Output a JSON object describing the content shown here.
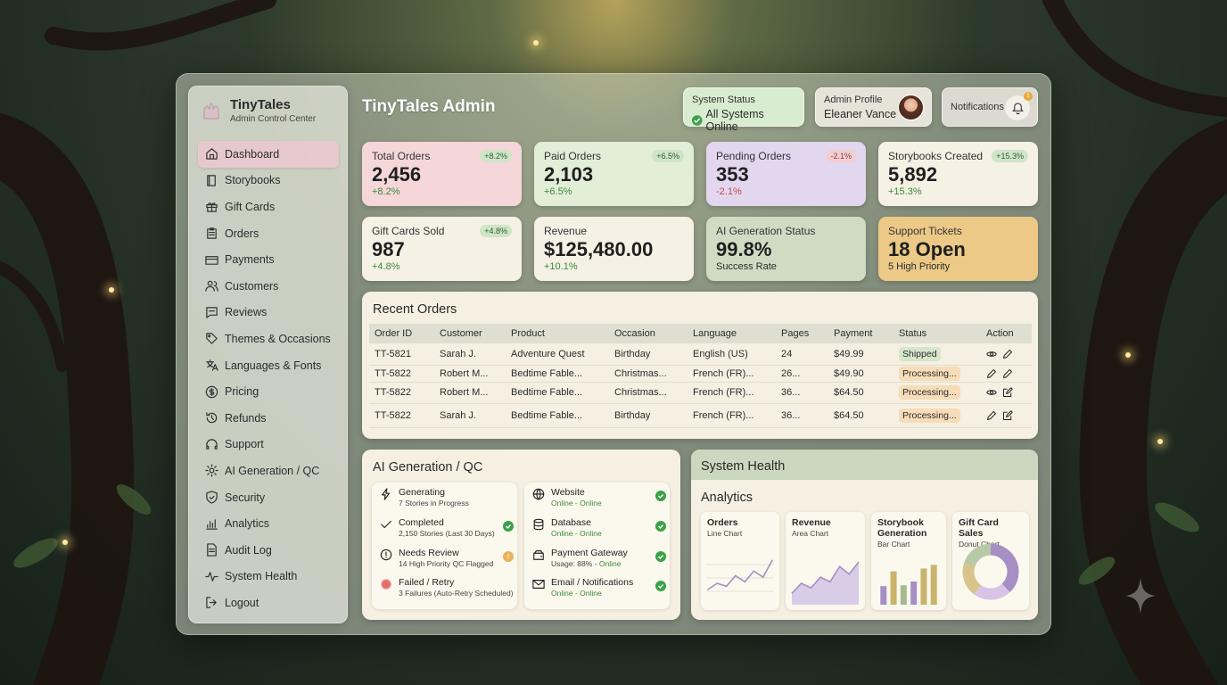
{
  "app": {
    "brand_name": "TinyTales",
    "brand_subtitle": "Admin Control Center",
    "title": "TinyTales Admin"
  },
  "sidebar": {
    "items": [
      {
        "label": "Dashboard",
        "icon": "home-icon",
        "active": true
      },
      {
        "label": "Storybooks",
        "icon": "book-icon"
      },
      {
        "label": "Gift Cards",
        "icon": "gift-icon"
      },
      {
        "label": "Orders",
        "icon": "clipboard-icon"
      },
      {
        "label": "Payments",
        "icon": "credit-card-icon"
      },
      {
        "label": "Customers",
        "icon": "users-icon"
      },
      {
        "label": "Reviews",
        "icon": "message-icon"
      },
      {
        "label": "Themes & Occasions",
        "icon": "tag-icon"
      },
      {
        "label": "Languages & Fonts",
        "icon": "translate-icon"
      },
      {
        "label": "Pricing",
        "icon": "dollar-icon"
      },
      {
        "label": "Refunds",
        "icon": "history-icon"
      },
      {
        "label": "Support",
        "icon": "headset-icon"
      },
      {
        "label": "AI Generation / QC",
        "icon": "gear-icon"
      },
      {
        "label": "Security",
        "icon": "shield-icon"
      },
      {
        "label": "Analytics",
        "icon": "bar-chart-icon"
      },
      {
        "label": "Audit Log",
        "icon": "document-icon"
      },
      {
        "label": "System Health",
        "icon": "pulse-icon"
      },
      {
        "label": "Logout",
        "icon": "logout-icon"
      }
    ]
  },
  "header": {
    "system_status_label": "System Status",
    "system_status_value": "All Systems Online",
    "profile_label": "Admin Profile",
    "profile_name": "Eleaner Vance",
    "notifications_label": "Notifications",
    "notifications_count": "1"
  },
  "stats": [
    {
      "label": "Total Orders",
      "value": "2,456",
      "sub": "+8.2%",
      "chip": "+8.2%",
      "trend": "up",
      "color": "#f5d6d9"
    },
    {
      "label": "Paid Orders",
      "value": "2,103",
      "sub": "+6.5%",
      "chip": "+6.5%",
      "trend": "up",
      "color": "#e2eed8"
    },
    {
      "label": "Pending Orders",
      "value": "353",
      "sub": "-2.1%",
      "chip": "-2.1%",
      "trend": "down",
      "color": "#e3d6ef"
    },
    {
      "label": "Storybooks Created",
      "value": "5,892",
      "sub": "+15.3%",
      "chip": "+15.3%",
      "trend": "up",
      "color": "#f5f1e4"
    },
    {
      "label": "Gift Cards Sold",
      "value": "987",
      "sub": "+4.8%",
      "chip": "+4.8%",
      "trend": "up",
      "color": "#f5f1e4"
    },
    {
      "label": "Revenue",
      "value": "$125,480.00",
      "sub": "+10.1%",
      "chip": "",
      "trend": "up",
      "color": "#f5f1e4"
    },
    {
      "label": "AI Generation Status",
      "value": "99.8%",
      "sub": "Success Rate",
      "chip": "",
      "trend": "neutral",
      "color": "#cfdcc3"
    },
    {
      "label": "Support Tickets",
      "value": "18 Open",
      "sub": "5 High Priority",
      "chip": "",
      "trend": "neutral",
      "color": "#ecc987"
    }
  ],
  "recent_orders": {
    "title": "Recent Orders",
    "columns": [
      "Order ID",
      "Customer",
      "Product",
      "Occasion",
      "Language",
      "Pages",
      "Payment",
      "Status",
      "Action"
    ],
    "rows": [
      {
        "id": "TT-5821",
        "customer": "Sarah J.",
        "product": "Adventure Quest",
        "occasion": "Birthday",
        "language": "English (US)",
        "pages": "24",
        "payment": "$49.99",
        "status": "Shipped",
        "actions": [
          "eye-icon",
          "pencil-icon"
        ]
      },
      {
        "id": "TT-5822",
        "customer": "Robert M...",
        "product": "Bedtime Fable...",
        "occasion": "Christmas...",
        "language": "French (FR)...",
        "pages": "26...",
        "payment": "$49.90",
        "status": "Processing...",
        "actions": [
          "pencil-icon",
          "pencil-icon"
        ]
      },
      {
        "id": "TT-5822",
        "customer": "Robert M...",
        "product": "Bedtime Fable...",
        "occasion": "Christmas...",
        "language": "French (FR)...",
        "pages": "36...",
        "payment": "$64.50",
        "status": "Processing...",
        "actions": [
          "eye-icon",
          "edit-icon"
        ]
      },
      {
        "id": "TT-5822",
        "customer": "Sarah J.",
        "product": "Bedtime Fable...",
        "occasion": "Birthday",
        "language": "French (FR)...",
        "pages": "36...",
        "payment": "$64.50",
        "status": "Processing...",
        "actions": [
          "pencil-icon",
          "edit-icon"
        ]
      }
    ]
  },
  "ai_generation": {
    "title": "AI Generation / QC",
    "left": [
      {
        "title": "Generating",
        "sub": "7 Stories in Progress",
        "icon": "lightning-icon",
        "state": ""
      },
      {
        "title": "Completed",
        "sub": "2,150 Stories (Last 30 Days)",
        "icon": "check-icon",
        "state": "ok"
      },
      {
        "title": "Needs Review",
        "sub": "14 High Priority QC Flagged",
        "icon": "alert-icon",
        "state": "warn"
      },
      {
        "title": "Failed / Retry",
        "sub": "3 Failures (Auto-Retry Scheduled)",
        "icon": "error-dot-icon",
        "state": ""
      }
    ],
    "right": [
      {
        "title": "Website",
        "sub": "Online - Online",
        "icon": "globe-icon"
      },
      {
        "title": "Database",
        "sub": "Online - Online",
        "icon": "database-icon"
      },
      {
        "title": "Payment Gateway",
        "sub_prefix": "Usage: 88% - ",
        "sub": "Online",
        "icon": "wallet-icon"
      },
      {
        "title": "Email / Notifications",
        "sub": "Online - Online",
        "icon": "mail-icon"
      }
    ]
  },
  "system_health": {
    "title": "System Health",
    "subtitle": "Analytics",
    "charts": [
      {
        "title": "Orders",
        "sub": "Line Chart"
      },
      {
        "title": "Revenue",
        "sub": "Area Chart"
      },
      {
        "title": "Storybook Generation",
        "sub": "Bar Chart"
      },
      {
        "title": "Gift Card Sales",
        "sub": "Donut Chart"
      }
    ]
  },
  "colors": {
    "accent_pink": "#ebc8d0",
    "ok_green": "#3aa247",
    "warn_orange": "#e7a93a",
    "chart_purple": "#a58fc4"
  },
  "chart_data": [
    {
      "type": "line",
      "title": "Orders",
      "x": [
        1,
        2,
        3,
        4,
        5,
        6,
        7,
        8
      ],
      "y": [
        20,
        28,
        24,
        38,
        30,
        44,
        36,
        58
      ]
    },
    {
      "type": "area",
      "title": "Revenue",
      "x": [
        1,
        2,
        3,
        4,
        5,
        6,
        7,
        8
      ],
      "y": [
        15,
        28,
        22,
        36,
        30,
        50,
        40,
        56
      ]
    },
    {
      "type": "bar",
      "title": "Storybook Generation",
      "categories": [
        "1",
        "2",
        "3",
        "4",
        "5",
        "6"
      ],
      "values": [
        40,
        72,
        42,
        50,
        78,
        86
      ],
      "colors": [
        "#a58fc4",
        "#c9b46c",
        "#a7b98f",
        "#a58fc4",
        "#c9b46c",
        "#c9b46c"
      ]
    },
    {
      "type": "pie",
      "title": "Gift Card Sales",
      "values": [
        38,
        22,
        20,
        20
      ],
      "colors": [
        "#a58fc4",
        "#d9c3e6",
        "#d8c48a",
        "#b7c9a5"
      ]
    }
  ]
}
